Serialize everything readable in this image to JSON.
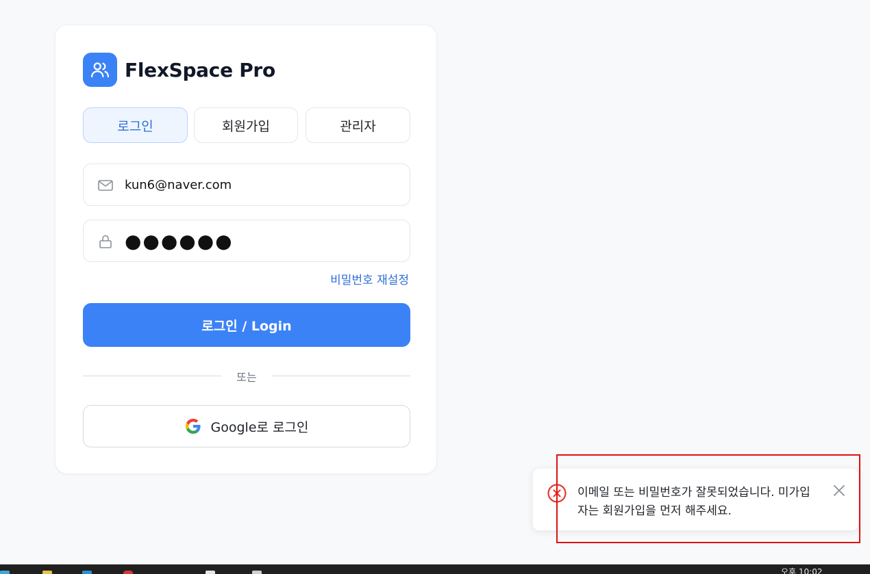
{
  "brand": {
    "title": "FlexSpace Pro",
    "logo_icon": "users-icon",
    "color": "#3b82f6"
  },
  "tabs": [
    {
      "label": "로그인",
      "active": true
    },
    {
      "label": "회원가입",
      "active": false
    },
    {
      "label": "관리자",
      "active": false
    }
  ],
  "form": {
    "email_value": "kun6@naver.com",
    "email_icon": "mail-icon",
    "password_masked": "●●●●●●",
    "password_icon": "lock-icon",
    "forgot_link": "비밀번호 재설정",
    "submit_label": "로그인 / Login",
    "divider_text": "또는",
    "google_label": "Google로 로그인",
    "google_icon": "google-icon"
  },
  "toast": {
    "type": "error",
    "icon": "error-circle-icon",
    "message": "이메일 또는 비밀번호가 잘못되었습니다. 미가입자는 회원가입을 먼저 해주세요.",
    "close_icon": "close-icon",
    "error_color": "#e53935"
  },
  "taskbar": {
    "clock": "오후 10:02"
  },
  "colors": {
    "accent": "#3b82f6",
    "link": "#2f6fd8",
    "highlight": "#e01010"
  }
}
